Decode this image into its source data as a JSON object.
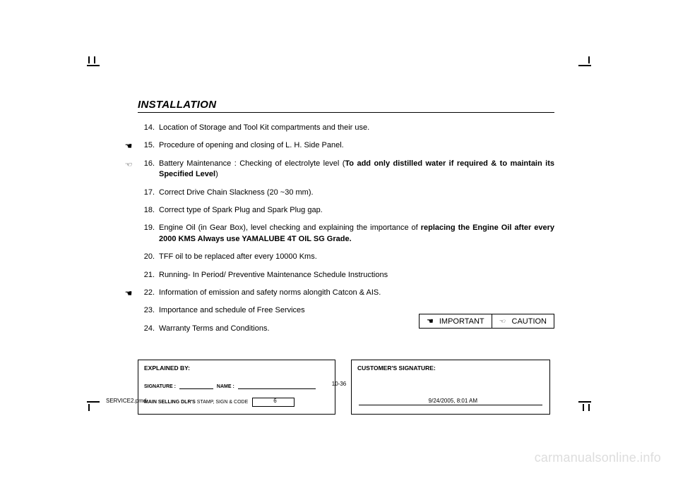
{
  "heading": "INSTALLATION",
  "items": [
    {
      "num": "14.",
      "mark": "",
      "text": "Location of Storage and Tool Kit compartments and their use."
    },
    {
      "num": "15.",
      "mark": "solid",
      "text": "Procedure of opening and closing of L. H. Side Panel."
    },
    {
      "num": "16.",
      "mark": "outline",
      "html": "Battery Maintenance : Checking of electrolyte level  (<b>To add only distilled water if required & to maintain its Specified Level</b>)"
    },
    {
      "num": "17.",
      "mark": "",
      "text": "Correct Drive Chain Slackness (20 ~30 mm)."
    },
    {
      "num": "18.",
      "mark": "",
      "text": "Correct type of Spark Plug and Spark Plug gap."
    },
    {
      "num": "19.",
      "mark": "",
      "html": "Engine Oil (in Gear Box), level checking and explaining the importance of <b>replacing the Engine Oil after every 2000 KMS Always use YAMALUBE 4T OIL SG Grade.</b>"
    },
    {
      "num": "20.",
      "mark": "",
      "text": "TFF oil to be replaced after every 10000 Kms."
    },
    {
      "num": "21.",
      "mark": "",
      "text": "Running- In Period/ Preventive Maintenance Schedule Instructions"
    },
    {
      "num": "22.",
      "mark": "solid",
      "text": "Information of emission and safety norms alongith Catcon & AIS."
    },
    {
      "num": "23.",
      "mark": "",
      "text": "Importance and schedule of Free Services"
    },
    {
      "num": "24.",
      "mark": "",
      "text": "Warranty Terms and Conditions."
    }
  ],
  "legend": {
    "important": "IMPORTANT",
    "caution": "CAUTION"
  },
  "explained_box": {
    "title": "EXPLAINED BY:",
    "signature_label": "SIGNATURE :",
    "name_label": "NAME :",
    "stamp_label_bold": "MAIN SELLING DLR'S",
    "stamp_label_rest": " STAMP, SIGN & CODE"
  },
  "customer_box": {
    "title": "CUSTOMER'S SIGNATURE:"
  },
  "page_number": "10-36",
  "footer": {
    "file": "SERVICE2.pmd",
    "page": "6",
    "timestamp": "9/24/2005, 8:01 AM"
  },
  "watermark": "carmanualsonline.info"
}
